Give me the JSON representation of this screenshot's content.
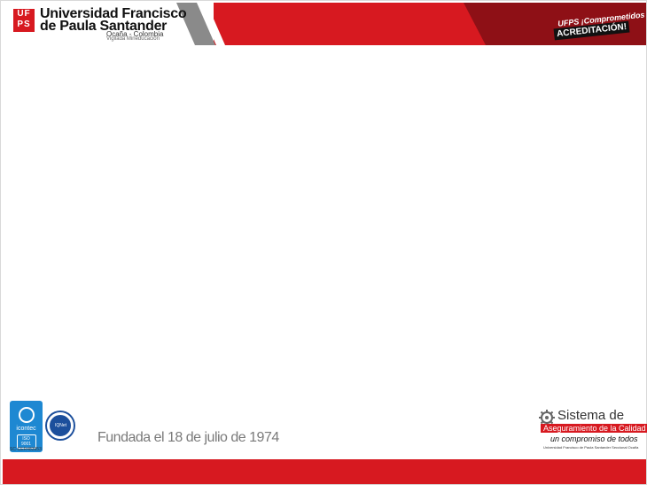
{
  "header": {
    "logo_mark": [
      "UF",
      "PS"
    ],
    "university_line1": "Universidad Francisco",
    "university_line2": "de Paula Santander",
    "location": "Ocaña - Colombia",
    "vigilance": "Vigilada Mineducación",
    "accreditation_line1": "UFPS ¡Comprometidos con la!",
    "accreditation_line2": "ACREDITACIÓN!"
  },
  "footer": {
    "icontec_name": "icontec",
    "icontec_iso": "ISO 9001",
    "icontec_cert": "SC-CER483953",
    "iqnet_label": "IQNet",
    "founded": "Fundada el 18 de julio de 1974",
    "sac_title1": "Sistema de",
    "sac_title2": "Aseguramiento de la Calidad",
    "sac_tagline": "un compromiso de todos",
    "sac_small": "Universidad Francisco de Paula Santander Seccional Ocaña"
  },
  "colors": {
    "brand_red": "#d71920",
    "dark_red": "#8e1016",
    "icontec_blue": "#1e88d2",
    "iqnet_blue": "#1c4f9c",
    "text_gray": "#7a7a7a"
  }
}
